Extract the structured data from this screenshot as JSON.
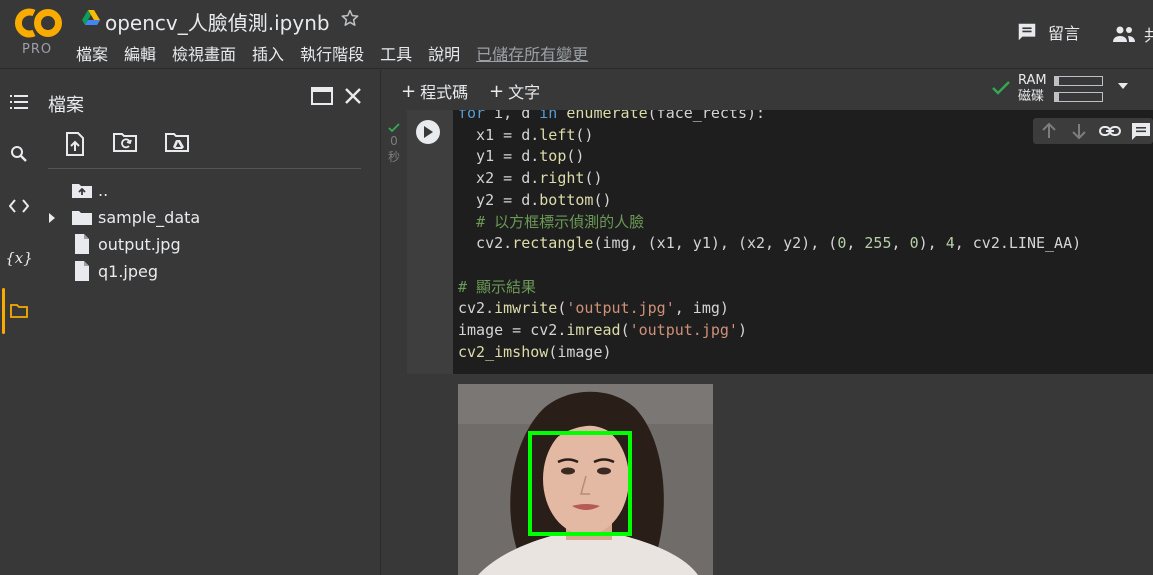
{
  "app": {
    "logo_text": "CO",
    "plan_badge": "PRO",
    "notebook_title": "opencv_人臉偵測.ipynb"
  },
  "menu": {
    "items": [
      "檔案",
      "編輯",
      "檢視畫面",
      "插入",
      "執行階段",
      "工具",
      "說明"
    ],
    "save_status": "已儲存所有變更"
  },
  "header_actions": {
    "comment_label": "留言",
    "share_label": "共"
  },
  "rail": {
    "icons": [
      "table-of-contents-icon",
      "search-icon",
      "code-snippets-icon",
      "variables-icon",
      "files-icon"
    ],
    "variables_glyph": "{x}",
    "active": "files-icon"
  },
  "file_panel": {
    "title": "檔案",
    "tree": [
      {
        "name": "..",
        "type": "parent"
      },
      {
        "name": "sample_data",
        "type": "folder"
      },
      {
        "name": "output.jpg",
        "type": "file"
      },
      {
        "name": "q1.jpeg",
        "type": "file"
      }
    ]
  },
  "toolbar": {
    "add_code_label": "程式碼",
    "add_text_label": "文字",
    "ram_label": "RAM",
    "disk_label": "磁碟",
    "ram_usage": 0.08,
    "disk_usage": 0.08
  },
  "cell": {
    "exec_count": "0",
    "exec_unit": "秒",
    "status": "completed"
  },
  "colors": {
    "accent": "#f9ab00",
    "success": "#34a853",
    "background": "#383838",
    "code_background": "#1e1e1e"
  }
}
